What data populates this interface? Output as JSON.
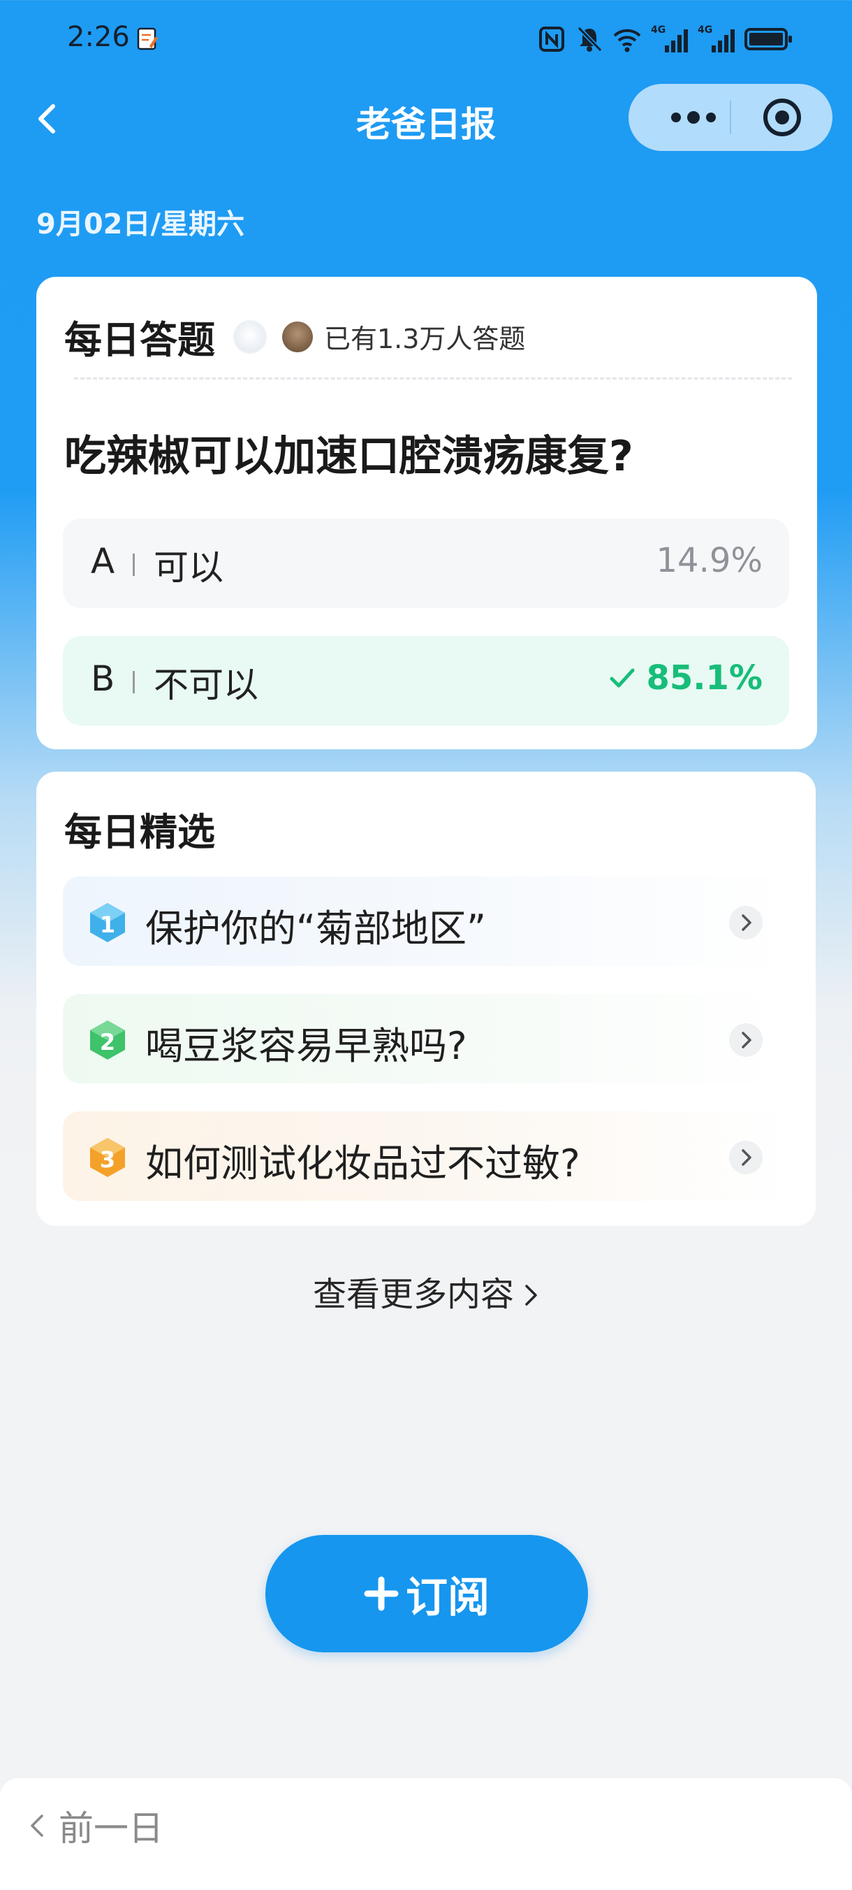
{
  "status_bar": {
    "time": "2:26",
    "network_labels": [
      "4G",
      "4G"
    ]
  },
  "nav": {
    "title": "老爸日报"
  },
  "date": "9月02日/星期六",
  "quiz": {
    "title": "每日答题",
    "answered_count": "已有1.3万人答题",
    "question": "吃辣椒可以加速口腔溃疡康复?",
    "options": [
      {
        "letter": "A",
        "text": "可以",
        "percent": "14.9%",
        "correct": false
      },
      {
        "letter": "B",
        "text": "不可以",
        "percent": "85.1%",
        "correct": true
      }
    ]
  },
  "picks": {
    "title": "每日精选",
    "items": [
      {
        "rank": "1",
        "text": "保护你的“菊部地区”"
      },
      {
        "rank": "2",
        "text": "喝豆浆容易早熟吗?"
      },
      {
        "rank": "3",
        "text": "如何测试化妆品过不过敏?"
      }
    ]
  },
  "more_link": "查看更多内容",
  "subscribe_label": "订阅",
  "prev_day": "前一日",
  "colors": {
    "primary": "#1696ee",
    "correct": "#18bd7a",
    "rank1": "#3fb0ea",
    "rank2": "#3ec26a",
    "rank3": "#f4a12a"
  }
}
